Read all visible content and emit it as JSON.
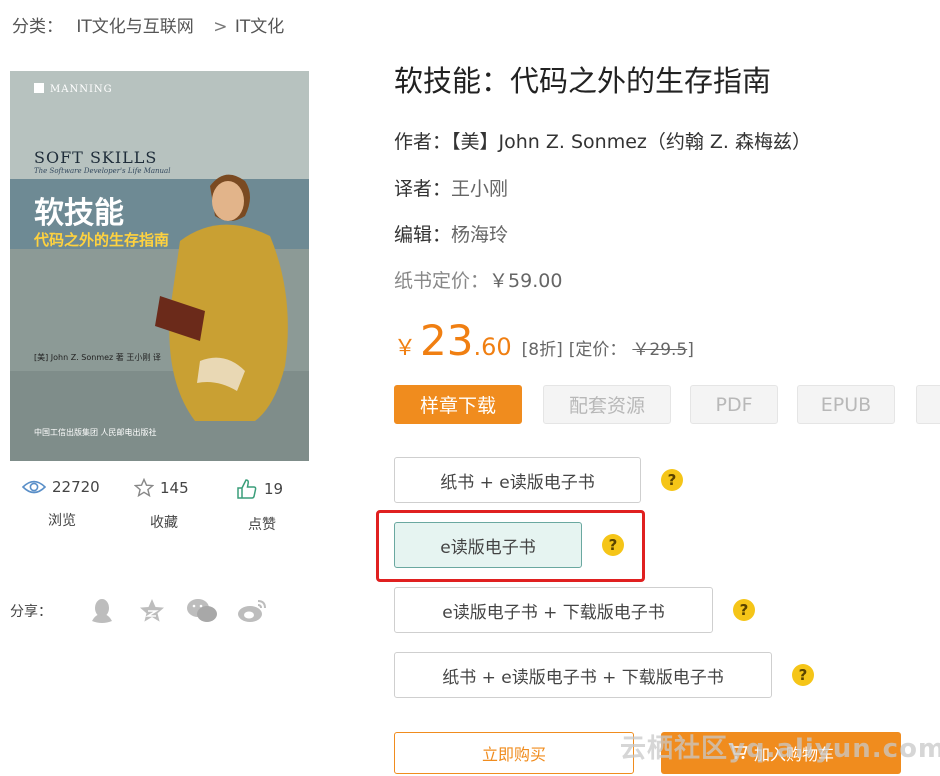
{
  "breadcrumb": {
    "label": "分类：",
    "category": "IT文化与互联网",
    "separator": ">",
    "subcategory": "IT文化"
  },
  "cover": {
    "publisher": "MANNING",
    "en_title": "SOFT SKILLS",
    "en_subtitle": "The Software Developer's Life Manual",
    "cn_title": "软技能",
    "cn_subtitle": "代码之外的生存指南",
    "author_line": "[美] John Z. Sonmez 著  王小刚 译",
    "publisher_logos": "中国工信出版集团   人民邮电出版社"
  },
  "stats": {
    "views": {
      "count": "22720",
      "label": "浏览",
      "icon": "eye-icon"
    },
    "favorites": {
      "count": "145",
      "label": "收藏",
      "icon": "star-icon"
    },
    "likes": {
      "count": "19",
      "label": "点赞",
      "icon": "thumbs-up-icon"
    }
  },
  "share": {
    "label": "分享：",
    "icons": [
      "qq-icon",
      "qzone-icon",
      "wechat-icon",
      "weibo-icon"
    ]
  },
  "book": {
    "title": "软技能：代码之外的生存指南",
    "author_label": "作者：",
    "author": "【美】John Z. Sonmez（约翰 Z. 森梅兹）",
    "translator_label": "译者：",
    "translator": "王小刚",
    "editor_label": "编辑：",
    "editor": "杨海玲",
    "list_price_label": "纸书定价：",
    "list_price": "￥59.00"
  },
  "price": {
    "currency": "￥",
    "integer": "23",
    "decimal": ".60",
    "discount": "[8折]",
    "orig_label": "[定价：",
    "orig_value": "￥29.5",
    "orig_close": "]"
  },
  "formats": {
    "sample": "样章下载",
    "resources": "配套资源",
    "pdf": "PDF",
    "epub": "EPUB"
  },
  "options": [
    {
      "label": "纸书 + e读版电子书",
      "selected": false
    },
    {
      "label": "e读版电子书",
      "selected": true
    },
    {
      "label": "e读版电子书 + 下载版电子书",
      "selected": false
    },
    {
      "label": "纸书 + e读版电子书 + 下载版电子书",
      "selected": false
    }
  ],
  "help_glyph": "?",
  "actions": {
    "buy": "立即购买",
    "cart": "加入购物车"
  },
  "watermark": "云栖社区yq.aliyun.com",
  "colors": {
    "accent": "#f08c1e",
    "highlight": "#e02020",
    "help": "#f5c518",
    "selected_bg": "#e6f4f1"
  }
}
